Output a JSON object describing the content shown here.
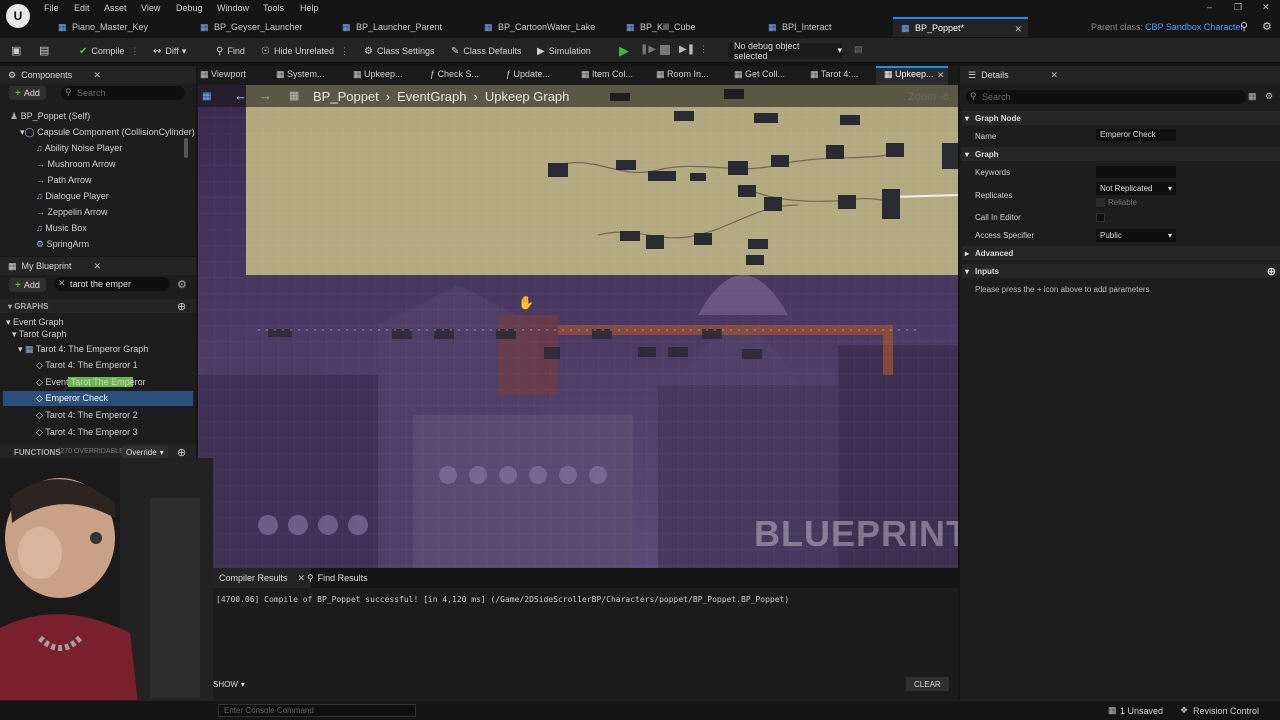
{
  "menu": [
    "File",
    "Edit",
    "Asset",
    "View",
    "Debug",
    "Window",
    "Tools",
    "Help"
  ],
  "tabs": [
    {
      "label": "Piano_Master_Key"
    },
    {
      "label": "BP_Geyser_Launcher"
    },
    {
      "label": "BP_Launcher_Parent"
    },
    {
      "label": "BP_CartoonWater_Lake"
    },
    {
      "label": "BP_Kill_Cube"
    },
    {
      "label": "BPI_Interact"
    },
    {
      "label": "BP_Poppet*"
    }
  ],
  "parent_class_label": "Parent class:",
  "parent_class_value": "CBP Sandbox Character",
  "toolbar": {
    "compile": "Compile",
    "diff": "Diff",
    "find": "Find",
    "hide_unrelated": "Hide Unrelated",
    "class_settings": "Class Settings",
    "class_defaults": "Class Defaults",
    "simulation": "Simulation",
    "debug_object": "No debug object selected"
  },
  "components": {
    "title": "Components",
    "add": "Add",
    "search_placeholder": "Search",
    "items": [
      "BP_Poppet (Self)",
      "Capsule Component (CollisionCylinder)",
      "Ability Noise Player",
      "Mushroom Arrow",
      "Path Arrow",
      "Dialogue Player",
      "Zeppelin Arrow",
      "Music Box",
      "SpringArm"
    ]
  },
  "my_blueprint": {
    "title": "My Blueprint",
    "add": "Add",
    "search_value": "tarot the emper",
    "graphs_label": "GRAPHS",
    "event_graph": "Event Graph",
    "tarot_graph": "Tarot Graph",
    "emperor_graph": "Tarot 4: The Emperor Graph",
    "items": [
      "Tarot 4: The Emperor 1",
      "Event Tarot The Emperor",
      "Emperor Check",
      "Tarot 4: The Emperor 2",
      "Tarot 4: The Emperor 3"
    ],
    "functions_label": "FUNCTIONS",
    "functions_count": "(270 OVERRIDABLE)",
    "override": "Override"
  },
  "graph_tabs": [
    "Viewport",
    "System...",
    "Upkeep...",
    "Check S...",
    "Update...",
    "Item Col...",
    "Room In...",
    "Get Coll...",
    "Tarot 4:...",
    "Upkeep..."
  ],
  "breadcrumb": [
    "BP_Poppet",
    "EventGraph",
    "Upkeep Graph"
  ],
  "zoom": "Zoom -8",
  "watermark": "BLUEPRINT",
  "bottom": {
    "tab1": "Compiler Results",
    "tab2": "Find Results",
    "log": "[4700.06] Compile of BP_Poppet successful! [in 4,120 ms] (/Game/2DSideScrollerBP/Characters/poppet/BP_Poppet.BP_Poppet)",
    "show": "SHOW",
    "clear": "CLEAR"
  },
  "details": {
    "title": "Details",
    "search_placeholder": "Search",
    "graph_node": "Graph Node",
    "name_label": "Name",
    "name_value": "Emperor Check",
    "graph": "Graph",
    "keywords": "Keywords",
    "replicates": "Replicates",
    "replicates_value": "Not Replicated",
    "reliable": "Reliable",
    "call_in_editor": "Call In Editor",
    "access_specifier": "Access Specifier",
    "access_value": "Public",
    "advanced": "Advanced",
    "inputs": "Inputs",
    "inputs_hint": "Please press the + icon above to add parameters"
  },
  "status": {
    "console_placeholder": "Enter Console Command",
    "unsaved": "1 Unsaved",
    "revision": "Revision Control"
  }
}
